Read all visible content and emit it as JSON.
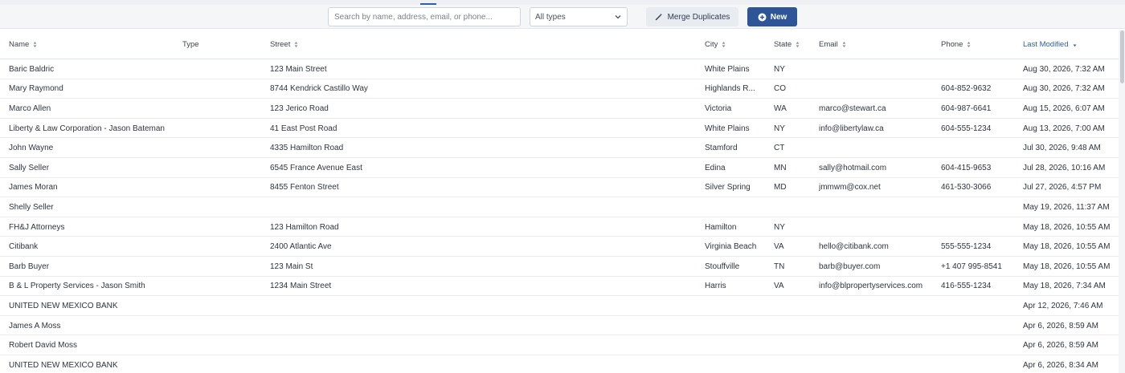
{
  "toolbar": {
    "search_placeholder": "Search by name, address, email, or phone...",
    "type_filter": "All types",
    "merge_label": "Merge Duplicates",
    "new_label": "New"
  },
  "table": {
    "columns": [
      {
        "key": "name",
        "label": "Name",
        "sortable": true
      },
      {
        "key": "type",
        "label": "Type",
        "sortable": false
      },
      {
        "key": "street",
        "label": "Street",
        "sortable": true
      },
      {
        "key": "city",
        "label": "City",
        "sortable": true
      },
      {
        "key": "state",
        "label": "State",
        "sortable": true
      },
      {
        "key": "email",
        "label": "Email",
        "sortable": true
      },
      {
        "key": "phone",
        "label": "Phone",
        "sortable": true
      },
      {
        "key": "modified",
        "label": "Last Modified",
        "sortable": true,
        "active": true
      }
    ],
    "rows": [
      {
        "name": "Baric Baldric",
        "type": "",
        "street": "123 Main Street",
        "city": "White Plains",
        "state": "NY",
        "email": "",
        "phone": "",
        "modified": "Aug 30, 2026, 7:32 AM"
      },
      {
        "name": "Mary Raymond",
        "type": "",
        "street": "8744 Kendrick Castillo Way",
        "city": "Highlands R...",
        "state": "CO",
        "email": "",
        "phone": "604-852-9632",
        "modified": "Aug 30, 2026, 7:32 AM"
      },
      {
        "name": "Marco Allen",
        "type": "",
        "street": "123 Jerico Road",
        "city": "Victoria",
        "state": "WA",
        "email": "marco@stewart.ca",
        "phone": "604-987-6641",
        "modified": "Aug 15, 2026, 6:07 AM"
      },
      {
        "name": "Liberty & Law Corporation - Jason Bateman",
        "type": "",
        "street": "41 East Post Road",
        "city": "White Plains",
        "state": "NY",
        "email": "info@libertylaw.ca",
        "phone": "604-555-1234",
        "modified": "Aug 13, 2026, 7:00 AM"
      },
      {
        "name": "John Wayne",
        "type": "",
        "street": "4335 Hamilton Road",
        "city": "Stamford",
        "state": "CT",
        "email": "",
        "phone": "",
        "modified": "Jul 30, 2026, 9:48 AM"
      },
      {
        "name": "Sally Seller",
        "type": "",
        "street": "6545 France Avenue East",
        "city": "Edina",
        "state": "MN",
        "email": "sally@hotmail.com",
        "phone": "604-415-9653",
        "modified": "Jul 28, 2026, 10:16 AM"
      },
      {
        "name": "James Moran",
        "type": "",
        "street": "8455 Fenton Street",
        "city": "Silver Spring",
        "state": "MD",
        "email": "jmmwm@cox.net",
        "phone": "461-530-3066",
        "modified": "Jul 27, 2026, 4:57 PM"
      },
      {
        "name": "Shelly Seller",
        "type": "",
        "street": "",
        "city": "",
        "state": "",
        "email": "",
        "phone": "",
        "modified": "May 19, 2026, 11:37 AM"
      },
      {
        "name": "FH&J Attorneys",
        "type": "",
        "street": "123 Hamilton Road",
        "city": "Hamilton",
        "state": "NY",
        "email": "",
        "phone": "",
        "modified": "May 18, 2026, 10:55 AM"
      },
      {
        "name": "Citibank",
        "type": "",
        "street": "2400 Atlantic Ave",
        "city": "Virginia Beach",
        "state": "VA",
        "email": "hello@citibank.com",
        "phone": "555-555-1234",
        "modified": "May 18, 2026, 10:55 AM"
      },
      {
        "name": "Barb Buyer",
        "type": "",
        "street": "123 Main St",
        "city": "Stouffville",
        "state": "TN",
        "email": "barb@buyer.com",
        "phone": "+1 407 995-8541",
        "modified": "May 18, 2026, 10:55 AM"
      },
      {
        "name": "B & L Property Services - Jason Smith",
        "type": "",
        "street": "1234 Main Street",
        "city": "Harris",
        "state": "VA",
        "email": "info@blpropertyservices.com",
        "phone": "416-555-1234",
        "modified": "May 18, 2026, 7:34 AM"
      },
      {
        "name": "UNITED NEW MEXICO BANK",
        "type": "",
        "street": "",
        "city": "",
        "state": "",
        "email": "",
        "phone": "",
        "modified": "Apr 12, 2026, 7:46 AM"
      },
      {
        "name": "James A Moss",
        "type": "",
        "street": "",
        "city": "",
        "state": "",
        "email": "",
        "phone": "",
        "modified": "Apr 6, 2026, 8:59 AM"
      },
      {
        "name": "Robert David Moss",
        "type": "",
        "street": "",
        "city": "",
        "state": "",
        "email": "",
        "phone": "",
        "modified": "Apr 6, 2026, 8:59 AM"
      },
      {
        "name": "UNITED NEW MEXICO BANK",
        "type": "",
        "street": "",
        "city": "",
        "state": "",
        "email": "",
        "phone": "",
        "modified": "Apr 6, 2026, 8:34 AM"
      }
    ]
  },
  "colors": {
    "accent": "#2d5597",
    "active_sort": "#2f5fa8"
  },
  "icons": {
    "merge": "magic-wand-icon",
    "new": "plus-circle-icon",
    "select": "chevron-down-icon",
    "sort": "sort-arrows-icon",
    "sort_desc": "sort-desc-icon"
  }
}
